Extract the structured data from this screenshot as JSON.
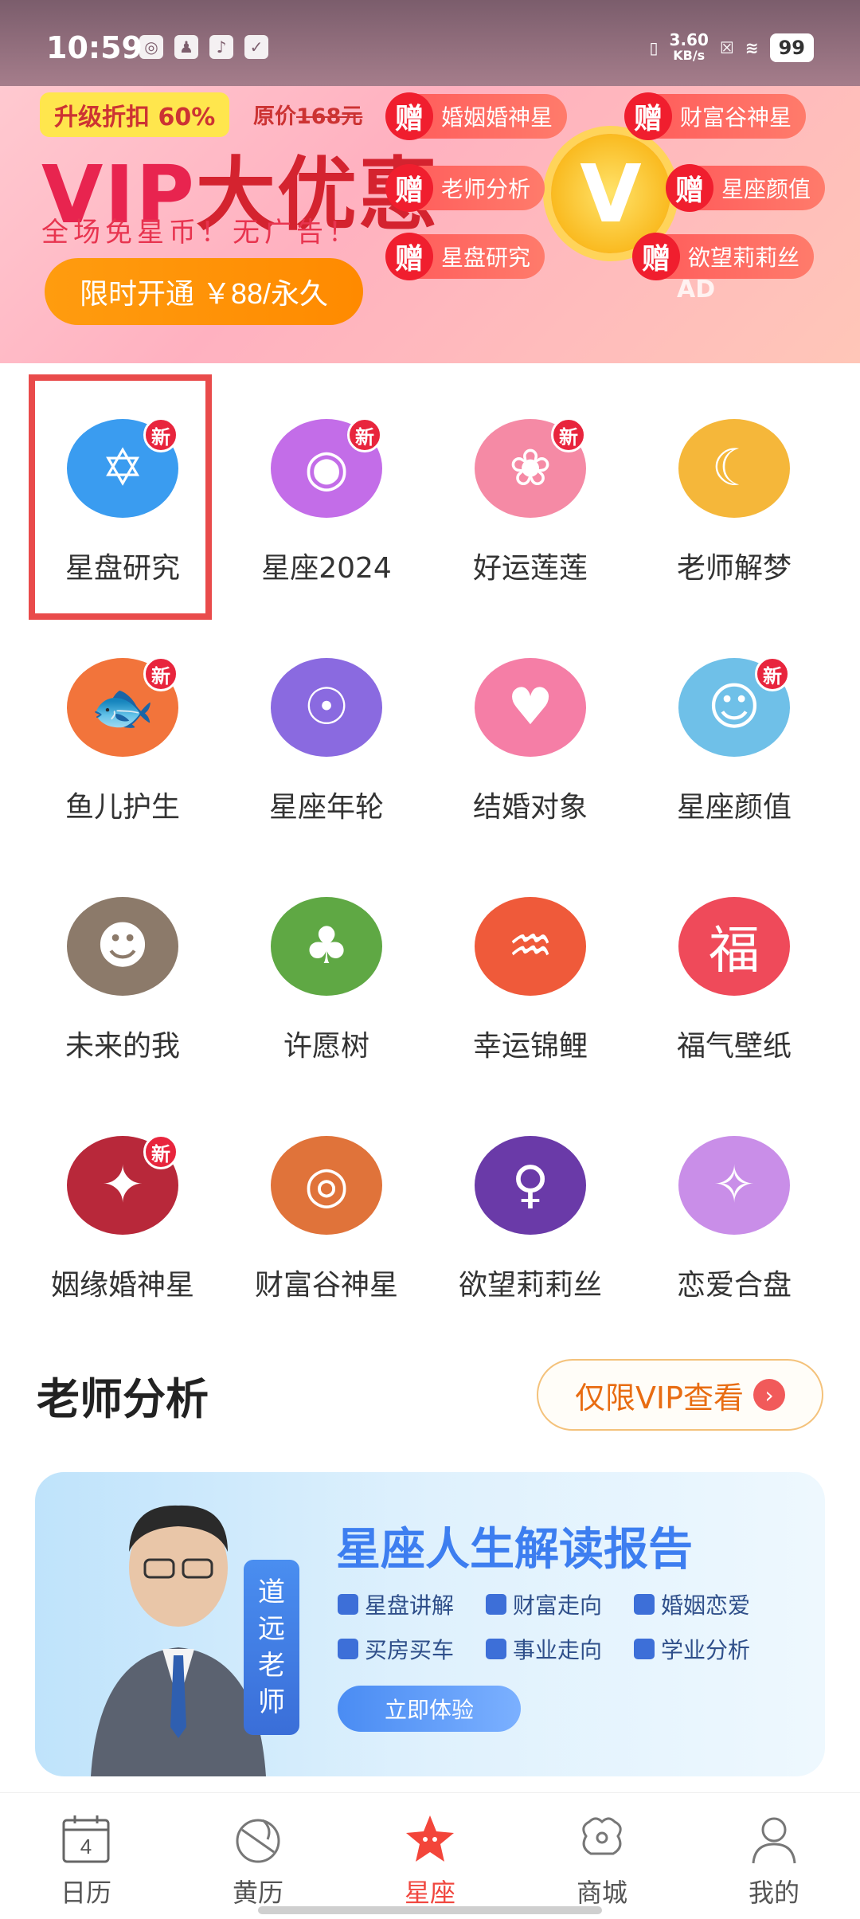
{
  "status": {
    "time": "10:59",
    "net_speed": "3.60",
    "net_unit": "KB/s",
    "battery": "99"
  },
  "banner": {
    "tag": "升级折扣 60%",
    "orig_prefix": "原价",
    "orig_price": "168元",
    "title_a": "VIP",
    "title_b": "大优惠",
    "subtitle": "全场免星币！无广告！",
    "button": "限时开通 ￥88/永久",
    "gift_char": "赠",
    "gifts": [
      "婚姻婚神星",
      "财富谷神星",
      "老师分析",
      "星座颜值",
      "星盘研究",
      "欲望莉莉丝"
    ],
    "coin": "V",
    "ad": "AD"
  },
  "grid": {
    "new_badge": "新",
    "items": [
      {
        "label": "星盘研究",
        "icon": "hexagram-icon",
        "color": "#3a9cf0"
      },
      {
        "label": "星座2024",
        "icon": "crystal-ball-icon",
        "color": "#c36de8"
      },
      {
        "label": "好运莲莲",
        "icon": "lotus-icon",
        "color": "#f58aa5"
      },
      {
        "label": "老师解梦",
        "icon": "moon-icon",
        "color": "#f5b73a"
      },
      {
        "label": "鱼儿护生",
        "icon": "koi-hands-icon",
        "color": "#f2743b"
      },
      {
        "label": "星座年轮",
        "icon": "zodiac-wheel-icon",
        "color": "#8a6ae0"
      },
      {
        "label": "结婚对象",
        "icon": "heart-icon",
        "color": "#f57ea6"
      },
      {
        "label": "星座颜值",
        "icon": "face-scan-icon",
        "color": "#6fc0e8"
      },
      {
        "label": "未来的我",
        "icon": "man-portrait-icon",
        "color": "#8c7a6a"
      },
      {
        "label": "许愿树",
        "icon": "wish-tree-icon",
        "color": "#5fa844"
      },
      {
        "label": "幸运锦鲤",
        "icon": "koi-icon",
        "color": "#ef5a3a"
      },
      {
        "label": "福气壁纸",
        "icon": "fortune-card-icon",
        "color": "#ef4a5a"
      },
      {
        "label": "姻缘婚神星",
        "icon": "compass-star-icon",
        "color": "#b8283a"
      },
      {
        "label": "财富谷神星",
        "icon": "target-disc-icon",
        "color": "#e0733a"
      },
      {
        "label": "欲望莉莉丝",
        "icon": "venus-moon-icon",
        "color": "#6a3aa8"
      },
      {
        "label": "恋爱合盘",
        "icon": "constellation-icon",
        "color": "#c98ee8"
      }
    ],
    "new_flags": [
      true,
      true,
      true,
      false,
      true,
      false,
      false,
      true,
      false,
      false,
      false,
      false,
      true,
      false,
      false,
      false
    ]
  },
  "section": {
    "title": "老师分析",
    "vip_button": "仅限VIP查看",
    "arrow": "›"
  },
  "card": {
    "teacher_name": [
      "道",
      "远",
      "老",
      "师"
    ],
    "title": "星座人生解读报告",
    "tags": [
      "星盘讲解",
      "财富走向",
      "婚姻恋爱",
      "买房买车",
      "事业走向",
      "学业分析"
    ],
    "button": "立即体验"
  },
  "tabs": [
    {
      "label": "日历",
      "icon": "calendar-icon",
      "day": "4"
    },
    {
      "label": "黄历",
      "icon": "almanac-icon"
    },
    {
      "label": "星座",
      "icon": "star-icon",
      "active": true
    },
    {
      "label": "商城",
      "icon": "shop-icon"
    },
    {
      "label": "我的",
      "icon": "profile-icon"
    }
  ]
}
